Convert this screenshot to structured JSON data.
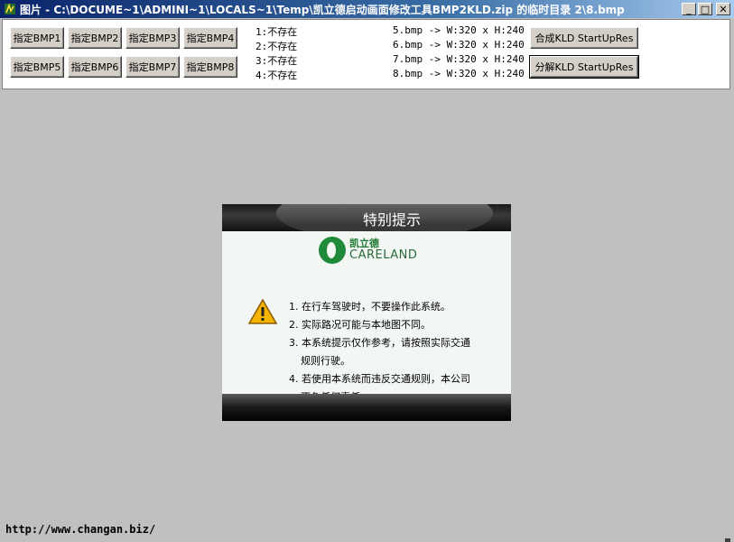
{
  "window": {
    "title": "图片 - C:\\DOCUME~1\\ADMINI~1\\LOCALS~1\\Temp\\凯立德启动画面修改工具BMP2KLD.zip 的临时目录 2\\8.bmp",
    "icon": "app-bmp-icon",
    "minimize_label": "_",
    "maximize_label": "□",
    "close_label": "✕"
  },
  "toolbar": {
    "assign_buttons": [
      "指定BMP1",
      "指定BMP2",
      "指定BMP3",
      "指定BMP4",
      "指定BMP5",
      "指定BMP6",
      "指定BMP7",
      "指定BMP8"
    ],
    "status_left": [
      "1:不存在",
      "2:不存在",
      "3:不存在",
      "4:不存在"
    ],
    "status_right": [
      "5.bmp -> W:320 x H:240",
      "6.bmp -> W:320 x H:240",
      "7.bmp -> W:320 x H:240",
      "8.bmp -> W:320 x H:240"
    ],
    "combine_label": "合成KLD StartUpRes",
    "split_label": "分解KLD StartUpRes"
  },
  "preview": {
    "title": "特别提示",
    "logo_cn": "凯立德",
    "logo_en": "CARELAND",
    "warning_icon": "warning-triangle-icon",
    "notices": [
      "1. 在行车驾驶时，不要操作此系统。",
      "2. 实际路况可能与本地图不同。",
      "3. 本系统提示仅作参考，请按照实际交通",
      "规则行驶。",
      "4. 若使用本系统而违反交通规则，本公司",
      "不负任何责任。"
    ]
  },
  "statusbar": {
    "url": "http://www.changan.biz/"
  },
  "colors": {
    "titlebar_start": "#0a246a",
    "titlebar_end": "#a6caf0",
    "workspace": "#c0c0c0",
    "brand_green": "#1e8a3a"
  }
}
